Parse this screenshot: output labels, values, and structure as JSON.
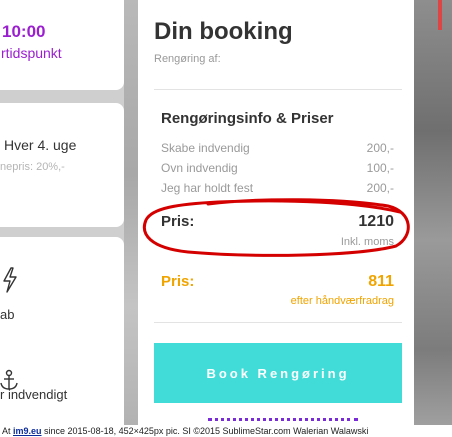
{
  "left_cards": {
    "time": {
      "value": "10:00",
      "label": "rtidspunkt"
    },
    "frequency": {
      "value": "Hver 4. uge",
      "discount": "nepris: 20%,-"
    },
    "extras": {
      "item1": "ab",
      "item2": "r indvendigt"
    }
  },
  "booking": {
    "title": "Din booking",
    "subtitle": "Rengøring af:",
    "info_title": "Rengøringsinfo & Priser",
    "items": [
      {
        "label": "Skabe indvendig",
        "price": "200,-"
      },
      {
        "label": "Ovn indvendig",
        "price": "100,-"
      },
      {
        "label": "Jeg har holdt fest",
        "price": "200,-"
      }
    ],
    "price": {
      "label": "Pris:",
      "value": "1210",
      "note": "Inkl. moms"
    },
    "after_deduction": {
      "label": "Pris:",
      "value": "811",
      "note": "efter håndværfradrag"
    },
    "book_button": "Book Rengøring"
  },
  "footer": {
    "prefix": "At ",
    "site": "im9.eu",
    "text": " since 2015-08-18, 452×425px pic.   SI ©2015 SublimeStar.com Walerian Walawski"
  },
  "colors": {
    "accent_purple": "#9b1fd0",
    "button_teal": "#41dcd7",
    "deduction_orange": "#f0a400",
    "annotation_red": "#d40000"
  },
  "icons": [
    "bolt-icon",
    "anchor-icon"
  ]
}
